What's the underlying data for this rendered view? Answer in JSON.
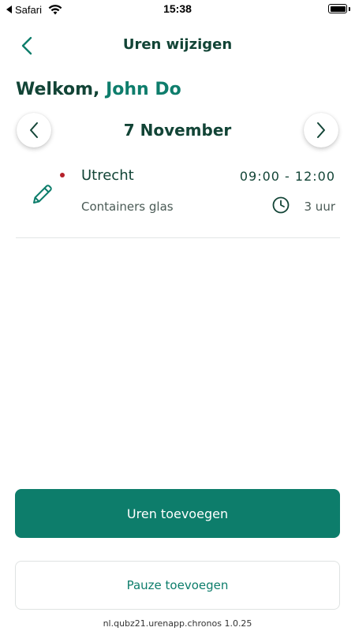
{
  "status_bar": {
    "back_app": "Safari",
    "time": "15:38",
    "back_icon": "back-triangle-icon",
    "wifi_icon": "wifi-icon",
    "battery_level": 1.0
  },
  "header": {
    "title": "Uren wijzigen",
    "back_icon": "chevron-left-icon"
  },
  "welcome": {
    "greeting": "Welkom,",
    "name": "John Do"
  },
  "date_nav": {
    "date": "7 November",
    "prev_icon": "chevron-left-icon",
    "next_icon": "chevron-right-icon"
  },
  "entries": [
    {
      "location": "Utrecht",
      "time_range": "09:00 - 12:00",
      "project": "Containers glas",
      "duration": "3 uur",
      "edit_icon": "pencil-icon",
      "clock_icon": "clock-icon",
      "status_color": "#b5202a"
    }
  ],
  "actions": {
    "add_hours": "Uren toevoegen",
    "add_break": "Pauze toevoegen"
  },
  "footer": {
    "version": "nl.qubz21.urenapp.chronos 1.0.25"
  },
  "colors": {
    "accent": "#0d7d6b",
    "text_dark": "#124436",
    "status_dot": "#b5202a"
  }
}
